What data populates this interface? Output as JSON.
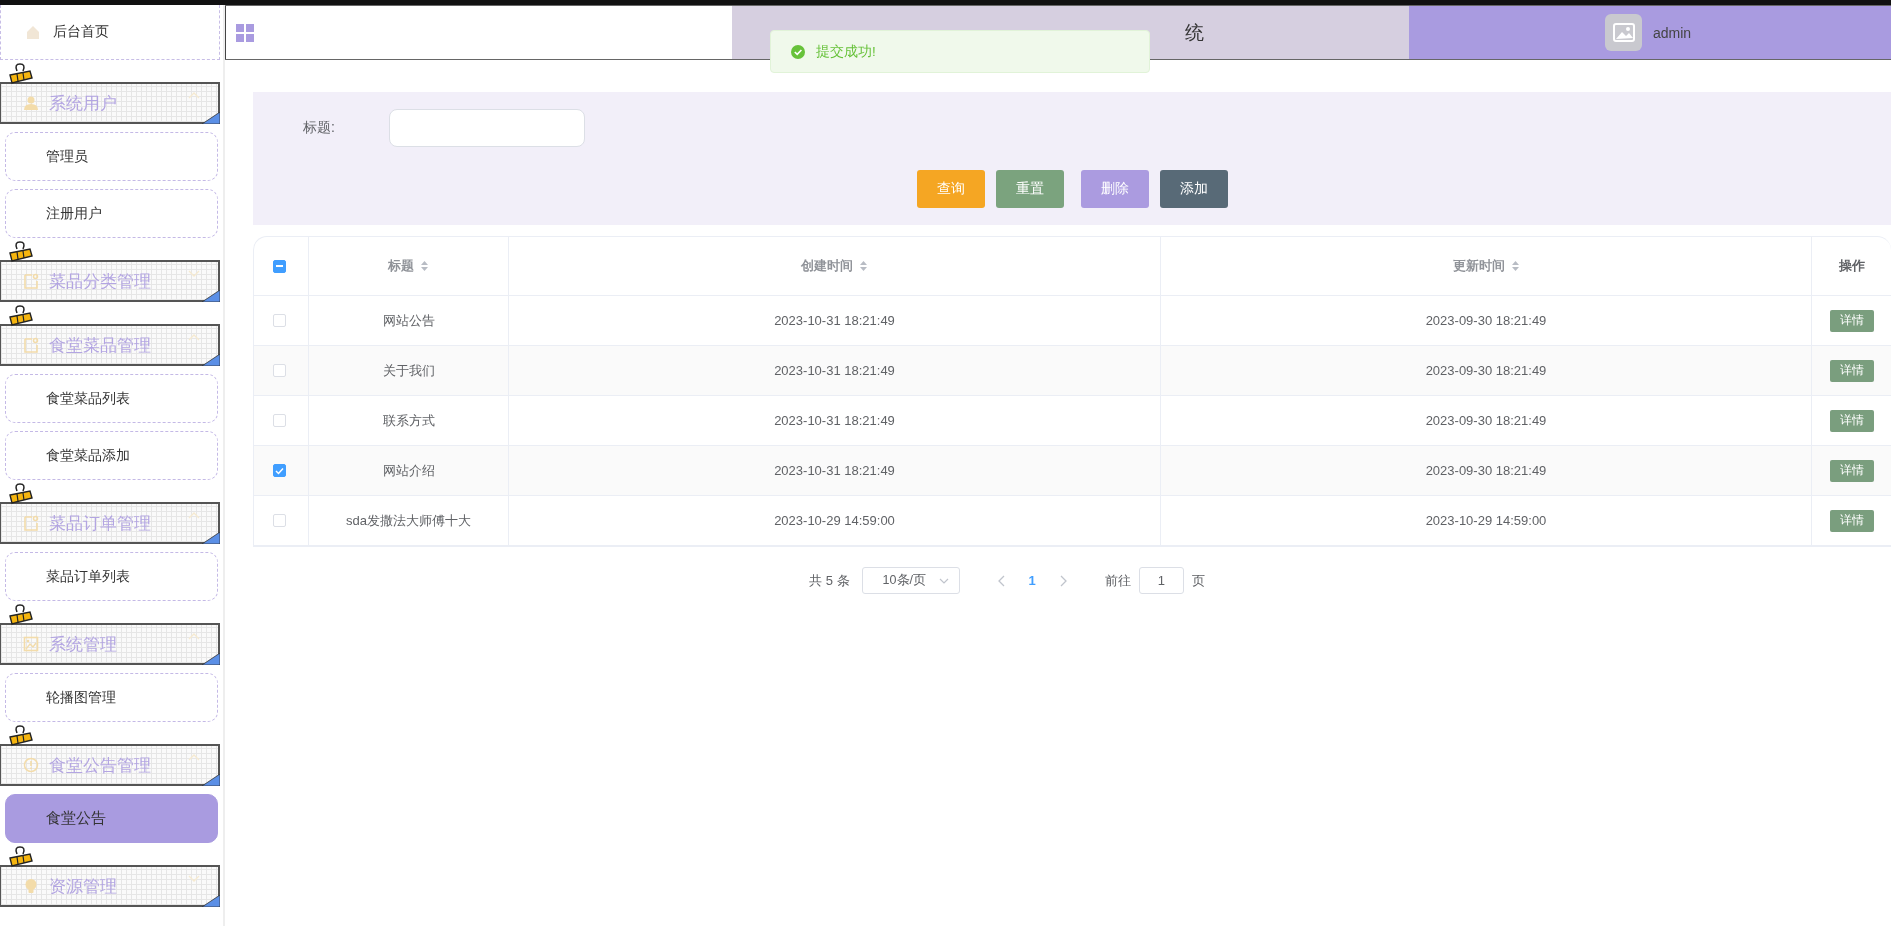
{
  "sidebar": {
    "items": [
      {
        "kind": "link",
        "label": "后台首页",
        "selected": false
      },
      {
        "kind": "group",
        "label": "系统用户",
        "expanded": true,
        "children": [
          {
            "label": "管理员",
            "selected": false
          },
          {
            "label": "注册用户",
            "selected": false
          }
        ]
      },
      {
        "kind": "group",
        "label": "菜品分类管理",
        "expanded": false
      },
      {
        "kind": "group",
        "label": "食堂菜品管理",
        "expanded": true,
        "children": [
          {
            "label": "食堂菜品列表",
            "selected": false
          },
          {
            "label": "食堂菜品添加",
            "selected": false
          }
        ]
      },
      {
        "kind": "group",
        "label": "菜品订单管理",
        "expanded": true,
        "children": [
          {
            "label": "菜品订单列表",
            "selected": false
          }
        ]
      },
      {
        "kind": "group",
        "label": "系统管理",
        "expanded": true,
        "children": [
          {
            "label": "轮播图管理",
            "selected": false
          }
        ]
      },
      {
        "kind": "group",
        "label": "食堂公告管理",
        "expanded": true,
        "children": [
          {
            "label": "食堂公告",
            "selected": true
          }
        ]
      },
      {
        "kind": "group",
        "label": "资源管理",
        "expanded": false
      }
    ]
  },
  "header": {
    "title": "统",
    "user": "admin"
  },
  "toast": {
    "message": "提交成功!"
  },
  "search": {
    "label": "标题:"
  },
  "buttons": [
    {
      "label": "查询",
      "color": "#f5a623"
    },
    {
      "label": "重置",
      "color": "#7ba37e"
    },
    {
      "label": "删除",
      "color": "#ab9be0"
    },
    {
      "label": "添加",
      "color": "#586a77"
    }
  ],
  "table": {
    "select_all_partial": true,
    "columns": [
      {
        "label": "标题",
        "sortable": true
      },
      {
        "label": "创建时间",
        "sortable": true
      },
      {
        "label": "更新时间",
        "sortable": true
      },
      {
        "label": "操作",
        "sortable": false
      }
    ],
    "rows": [
      {
        "selected": false,
        "cells": [
          "网站公告",
          "2023-10-31 18:21:49",
          "2023-09-30 18:21:49"
        ],
        "action": "详情"
      },
      {
        "selected": false,
        "cells": [
          "关于我们",
          "2023-10-31 18:21:49",
          "2023-09-30 18:21:49"
        ],
        "action": "详情"
      },
      {
        "selected": false,
        "cells": [
          "联系方式",
          "2023-10-31 18:21:49",
          "2023-09-30 18:21:49"
        ],
        "action": "详情"
      },
      {
        "selected": true,
        "cells": [
          "网站介绍",
          "2023-10-31 18:21:49",
          "2023-09-30 18:21:49"
        ],
        "action": "详情"
      },
      {
        "selected": false,
        "cells": [
          "sda发撒法大师傅十大",
          "2023-10-29 14:59:00",
          "2023-10-29 14:59:00"
        ],
        "action": "详情"
      }
    ]
  },
  "pagination": {
    "total": "共 5 条",
    "page_size": "10条/页",
    "pages": [
      {
        "label": "1",
        "selected": true
      }
    ],
    "goto_label": "前往",
    "goto_value": "1",
    "goto_suffix": "页"
  }
}
